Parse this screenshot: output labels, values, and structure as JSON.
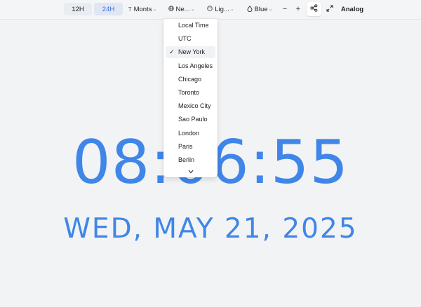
{
  "toolbar": {
    "format_12h": "12H",
    "format_24h": "24H",
    "active_format": "24H",
    "font_label": "Monts",
    "font_icon": "text-icon",
    "timezone_label": "Ne...",
    "timezone_icon": "globe-icon",
    "theme_label": "Lig...",
    "theme_icon": "palette-icon",
    "color_label": "Blue",
    "color_icon": "droplet-icon",
    "decrease_label": "−",
    "increase_label": "+",
    "share_icon": "share-icon",
    "fullscreen_icon": "expand-icon",
    "analog_label": "Analog"
  },
  "timezone_dropdown": {
    "items": [
      {
        "label": "Local Time"
      },
      {
        "label": "UTC"
      },
      {
        "label": "New York",
        "selected": true
      },
      {
        "label": "Los Angeles"
      },
      {
        "label": "Chicago"
      },
      {
        "label": "Toronto"
      },
      {
        "label": "Mexico City"
      },
      {
        "label": "Sao Paulo"
      },
      {
        "label": "London"
      },
      {
        "label": "Paris"
      },
      {
        "label": "Berlin"
      }
    ],
    "more_icon": "chevron-down-icon"
  },
  "clock": {
    "time": "08:06:55",
    "date": "WED, MAY 21, 2025",
    "color": "#3f86e8"
  },
  "colors": {
    "background": "#f1f3f5",
    "accent": "#3b6fd3"
  }
}
